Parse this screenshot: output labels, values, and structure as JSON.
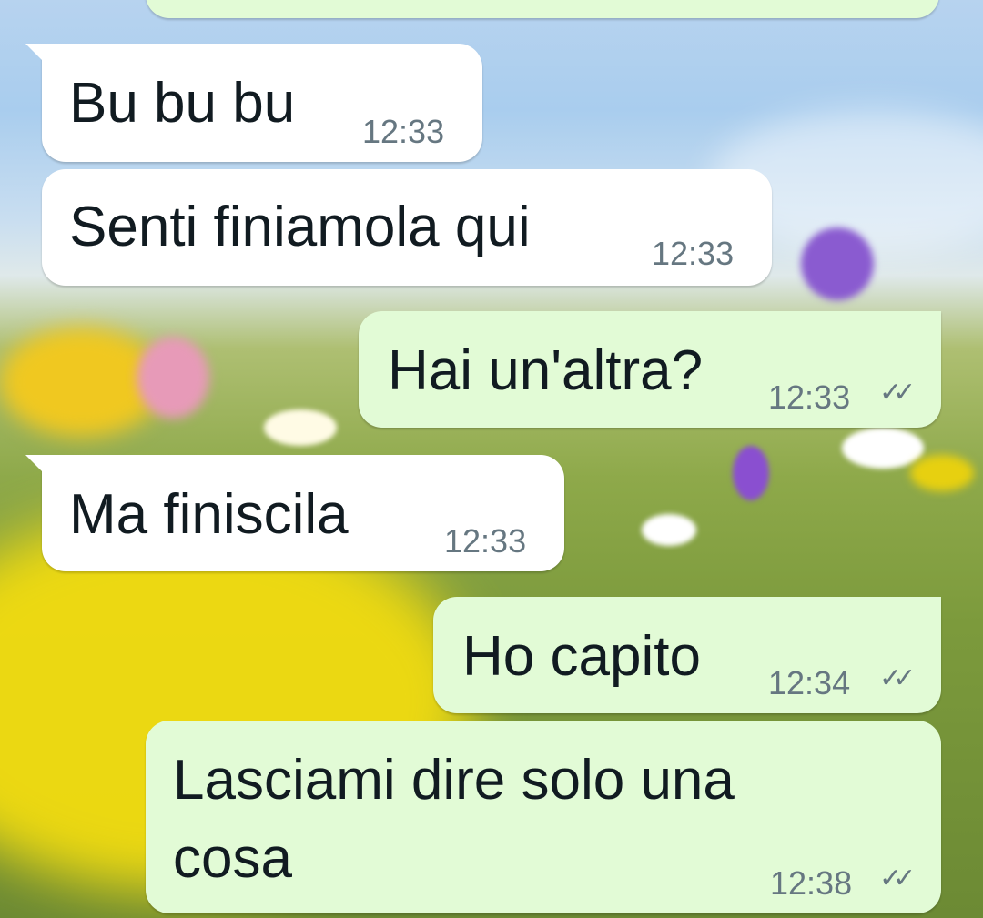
{
  "messages": [
    {
      "id": "m1",
      "direction": "incoming",
      "text": "Bu bu bu",
      "time": "12:33"
    },
    {
      "id": "m2",
      "direction": "incoming",
      "text": "Senti finiamola qui",
      "time": "12:33"
    },
    {
      "id": "m3",
      "direction": "outgoing",
      "text": "Hai un'altra?",
      "time": "12:33",
      "status_icon": "double-check-icon"
    },
    {
      "id": "m4",
      "direction": "incoming",
      "text": "Ma finiscila",
      "time": "12:33"
    },
    {
      "id": "m5",
      "direction": "outgoing",
      "text": "Ho capito",
      "time": "12:34",
      "status_icon": "double-check-icon"
    },
    {
      "id": "m6",
      "direction": "outgoing",
      "text_lines": [
        "Lasciami dire solo una",
        "cosa"
      ],
      "time": "12:38",
      "status_icon": "double-check-icon"
    }
  ],
  "colors": {
    "incoming_bubble": "#ffffff",
    "outgoing_bubble": "#e2fbd6",
    "text": "#111b21",
    "meta": "#667781"
  }
}
